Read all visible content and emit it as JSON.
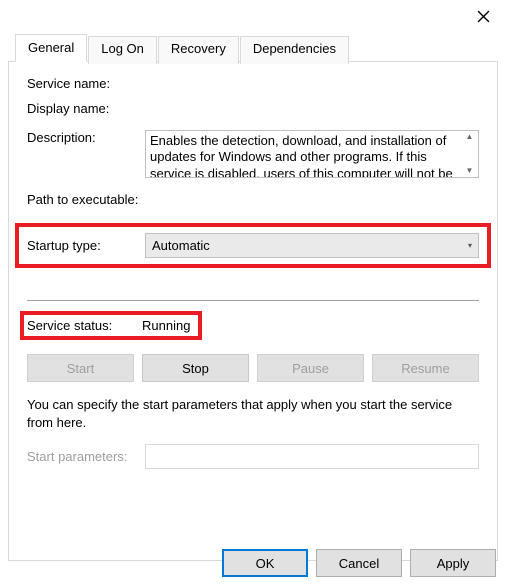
{
  "tabs": {
    "general": "General",
    "logon": "Log On",
    "recovery": "Recovery",
    "dependencies": "Dependencies"
  },
  "labels": {
    "service_name": "Service name:",
    "display_name": "Display name:",
    "description": "Description:",
    "path": "Path to executable:",
    "startup_type": "Startup type:",
    "service_status": "Service status:",
    "start_parameters": "Start parameters:"
  },
  "values": {
    "service_name": "",
    "display_name": "",
    "description": "Enables the detection, download, and installation of updates for Windows and other programs. If this service is disabled, users of this computer will not be",
    "path": "",
    "startup_type": "Automatic",
    "service_status": "Running",
    "start_parameters": ""
  },
  "buttons": {
    "start": "Start",
    "stop": "Stop",
    "pause": "Pause",
    "resume": "Resume",
    "ok": "OK",
    "cancel": "Cancel",
    "apply": "Apply"
  },
  "hint": "You can specify the start parameters that apply when you start the service from here."
}
